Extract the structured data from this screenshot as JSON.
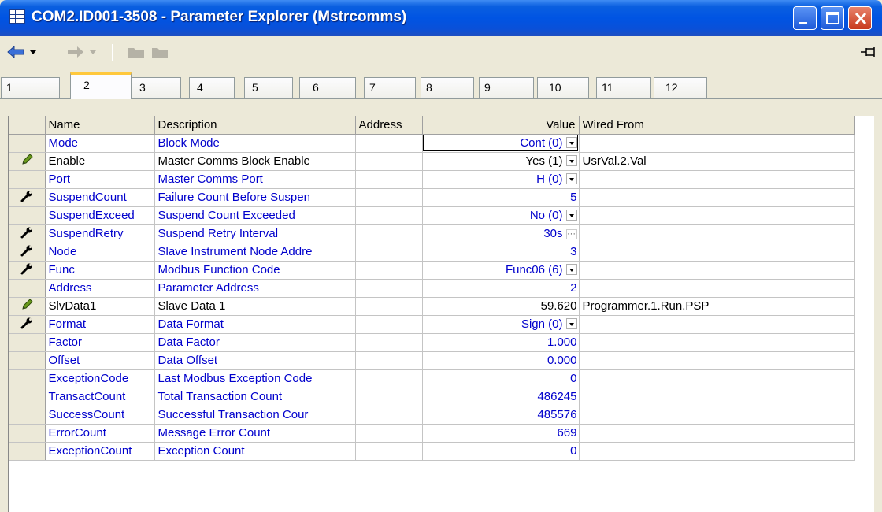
{
  "window": {
    "title": "COM2.ID001-3508 - Parameter Explorer (Mstrcomms)"
  },
  "tabs": [
    "1",
    "2",
    "3",
    "4",
    "5",
    "6",
    "7",
    "8",
    "9",
    "10",
    "11",
    "12"
  ],
  "active_tab": "2",
  "columns": {
    "name": "Name",
    "description": "Description",
    "address": "Address",
    "value": "Value",
    "wired_from": "Wired From"
  },
  "rows": [
    {
      "icon": "",
      "name": "Mode",
      "description": "Block Mode",
      "value": "Cont (0)",
      "control": "dropdown",
      "wired_from": "",
      "color": "blue"
    },
    {
      "icon": "pencil-icon",
      "name": "Enable",
      "description": "Master Comms Block Enable",
      "value": "Yes (1)",
      "control": "dropdown",
      "wired_from": "UsrVal.2.Val",
      "color": "black"
    },
    {
      "icon": "",
      "name": "Port",
      "description": "Master Comms Port",
      "value": "H (0)",
      "control": "dropdown",
      "wired_from": "",
      "color": "blue"
    },
    {
      "icon": "wrench-icon",
      "name": "SuspendCount",
      "description": "Failure Count Before Suspen",
      "value": "5",
      "control": "",
      "wired_from": "",
      "color": "blue"
    },
    {
      "icon": "",
      "name": "SuspendExceed",
      "description": "Suspend Count Exceeded",
      "value": "No (0)",
      "control": "dropdown",
      "wired_from": "",
      "color": "blue"
    },
    {
      "icon": "wrench-icon",
      "name": "SuspendRetry",
      "description": "Suspend Retry Interval",
      "value": "30s",
      "control": "ellipsis",
      "wired_from": "",
      "color": "blue"
    },
    {
      "icon": "wrench-icon",
      "name": "Node",
      "description": "Slave Instrument Node Addre",
      "value": "3",
      "control": "",
      "wired_from": "",
      "color": "blue"
    },
    {
      "icon": "wrench-icon",
      "name": "Func",
      "description": "Modbus Function Code",
      "value": "Func06 (6)",
      "control": "dropdown",
      "wired_from": "",
      "color": "blue"
    },
    {
      "icon": "",
      "name": "Address",
      "description": "Parameter Address",
      "value": "2",
      "control": "",
      "wired_from": "",
      "color": "blue"
    },
    {
      "icon": "pencil-icon",
      "name": "SlvData1",
      "description": "Slave Data 1",
      "value": "59.620",
      "control": "",
      "wired_from": "Programmer.1.Run.PSP",
      "color": "black"
    },
    {
      "icon": "wrench-icon",
      "name": "Format",
      "description": "Data Format",
      "value": "Sign (0)",
      "control": "dropdown",
      "wired_from": "",
      "color": "blue"
    },
    {
      "icon": "",
      "name": "Factor",
      "description": "Data Factor",
      "value": "1.000",
      "control": "",
      "wired_from": "",
      "color": "blue"
    },
    {
      "icon": "",
      "name": "Offset",
      "description": "Data Offset",
      "value": "0.000",
      "control": "",
      "wired_from": "",
      "color": "blue"
    },
    {
      "icon": "",
      "name": "ExceptionCode",
      "description": "Last Modbus Exception Code",
      "value": "0",
      "control": "",
      "wired_from": "",
      "color": "blue"
    },
    {
      "icon": "",
      "name": "TransactCount",
      "description": "Total Transaction Count",
      "value": "486245",
      "control": "",
      "wired_from": "",
      "color": "blue"
    },
    {
      "icon": "",
      "name": "SuccessCount",
      "description": "Successful Transaction Cour",
      "value": "485576",
      "control": "",
      "wired_from": "",
      "color": "blue"
    },
    {
      "icon": "",
      "name": "ErrorCount",
      "description": "Message Error Count",
      "value": "669",
      "control": "",
      "wired_from": "",
      "color": "blue"
    },
    {
      "icon": "",
      "name": "ExceptionCount",
      "description": "Exception Count",
      "value": "0",
      "control": "",
      "wired_from": "",
      "color": "blue"
    }
  ],
  "toolbar": {
    "back": "back-arrow-icon",
    "forward": "forward-arrow-icon",
    "folder_up": "folder-icon",
    "folder_open": "folder-icon",
    "pin": "pin-icon"
  },
  "colors": {
    "title_bar": "#0054e3",
    "tab_highlight": "#ffc83c",
    "value_text": "#0000cc"
  }
}
